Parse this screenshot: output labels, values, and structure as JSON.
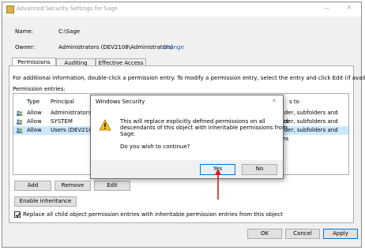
{
  "window": {
    "title": "Advanced Security Settings for Sage"
  },
  "name_label": "Name:",
  "name_value": "C:\\Sage",
  "owner_label": "Owner:",
  "owner_value": "Administrators (DEV2108\\Administrators)",
  "owner_change": "Change",
  "tabs": [
    {
      "label": "Permissions"
    },
    {
      "label": "Auditing"
    },
    {
      "label": "Effective Access"
    }
  ],
  "info_text": "For additional information, double-click a permission entry. To modify a permission entry, select the entry and click Edit (if available).",
  "entries_label": "Permission entries:",
  "table": {
    "headers": [
      "Type",
      "Principal",
      "s to"
    ],
    "rows": [
      {
        "type": "Allow",
        "principal": "Administrators (D",
        "applies": "folder, subfolders and files",
        "selected": false
      },
      {
        "type": "Allow",
        "principal": "SYSTEM",
        "applies": "folder, subfolders and files",
        "selected": false
      },
      {
        "type": "Allow",
        "principal": "Users (DEV2108\\U",
        "applies": "folder, subfolders and files",
        "selected": true
      }
    ]
  },
  "buttons": {
    "add": "Add",
    "remove": "Remove",
    "edit": "Edit",
    "enable_inheritance": "Enable inheritance",
    "ok": "OK",
    "cancel": "Cancel",
    "apply": "Apply"
  },
  "replace_checkbox": {
    "label": "Replace all child object permission entries with inheritable permission entries from this object",
    "checked": true
  },
  "dialog": {
    "title": "Windows Security",
    "message_lines": [
      "This will replace explicitly defined permissions on all",
      "descendants of this object with inheritable permissions from",
      "Sage."
    ],
    "question": "Do you wish to continue?",
    "yes": "Yes",
    "no": "No",
    "close_glyph": "✕"
  },
  "title_glyphs": {
    "minimize": "—",
    "close": "✕"
  },
  "colors": {
    "accent": "#0078d7",
    "link": "#1b5fb8",
    "arrow": "#d01c1c",
    "selected_row": "#cce8ff"
  }
}
